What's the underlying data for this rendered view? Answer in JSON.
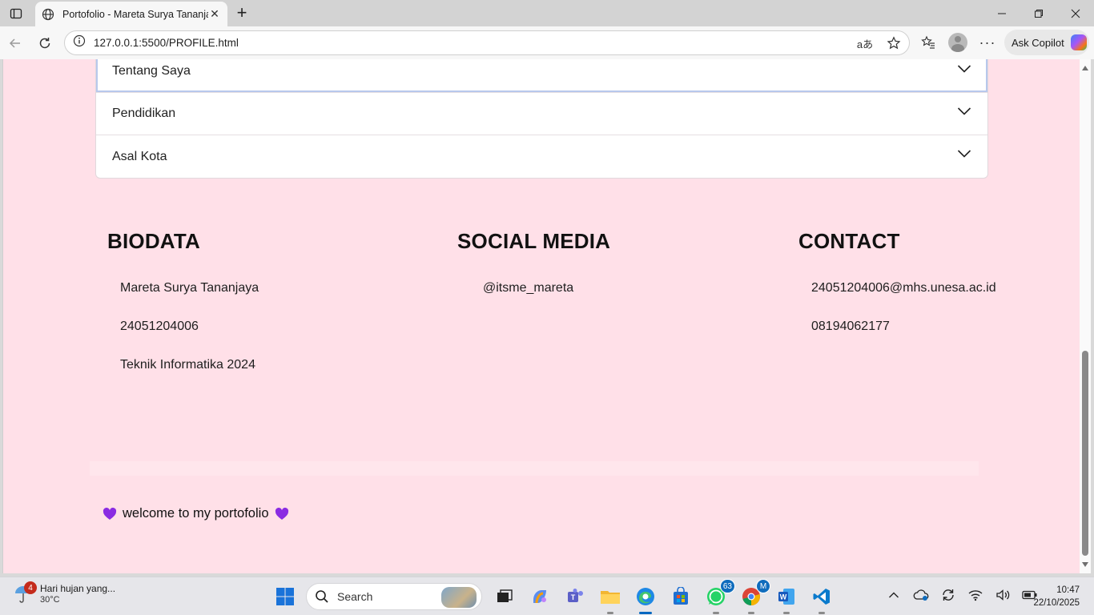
{
  "browser": {
    "tab_title": "Portofolio - Mareta Surya Tananjaya",
    "url": "127.0.0.1:5500/PROFILE.html",
    "copilot_label": "Ask Copilot",
    "icons": [
      "tab-actions-icon",
      "globe-icon",
      "close-icon",
      "new-tab-icon",
      "minimize-icon",
      "maximize-icon",
      "window-close-icon",
      "back-icon",
      "refresh-icon",
      "site-info-icon",
      "read-aloud-icon",
      "favorite-star-icon",
      "favorites-icon",
      "profile-icon",
      "more-icon",
      "copilot-icon"
    ]
  },
  "page": {
    "accordion": [
      {
        "label": "Tentang Saya",
        "active": true
      },
      {
        "label": "Pendidikan",
        "active": false
      },
      {
        "label": "Asal Kota",
        "active": false
      }
    ],
    "biodata": {
      "heading": "BIODATA",
      "items": [
        "Mareta Surya Tananjaya",
        "24051204006",
        "Teknik Informatika 2024"
      ]
    },
    "social": {
      "heading": "SOCIAL MEDIA",
      "items": [
        "@itsme_mareta"
      ]
    },
    "contact": {
      "heading": "CONTACT",
      "items": [
        "24051204006@mhs.unesa.ac.id",
        "08194062177"
      ]
    },
    "footer": {
      "text": "welcome to my portofolio",
      "heart_color": "#8a2be2"
    },
    "background_color": "#ffe0e8"
  },
  "taskbar": {
    "weather": {
      "badge": "4",
      "text": "Hari hujan yang...",
      "temp": "30°C"
    },
    "search_placeholder": "Search",
    "whatsapp_badge": "63",
    "chrome_badge": "M",
    "clock_time": "10:47",
    "clock_date": "22/10/2025"
  }
}
